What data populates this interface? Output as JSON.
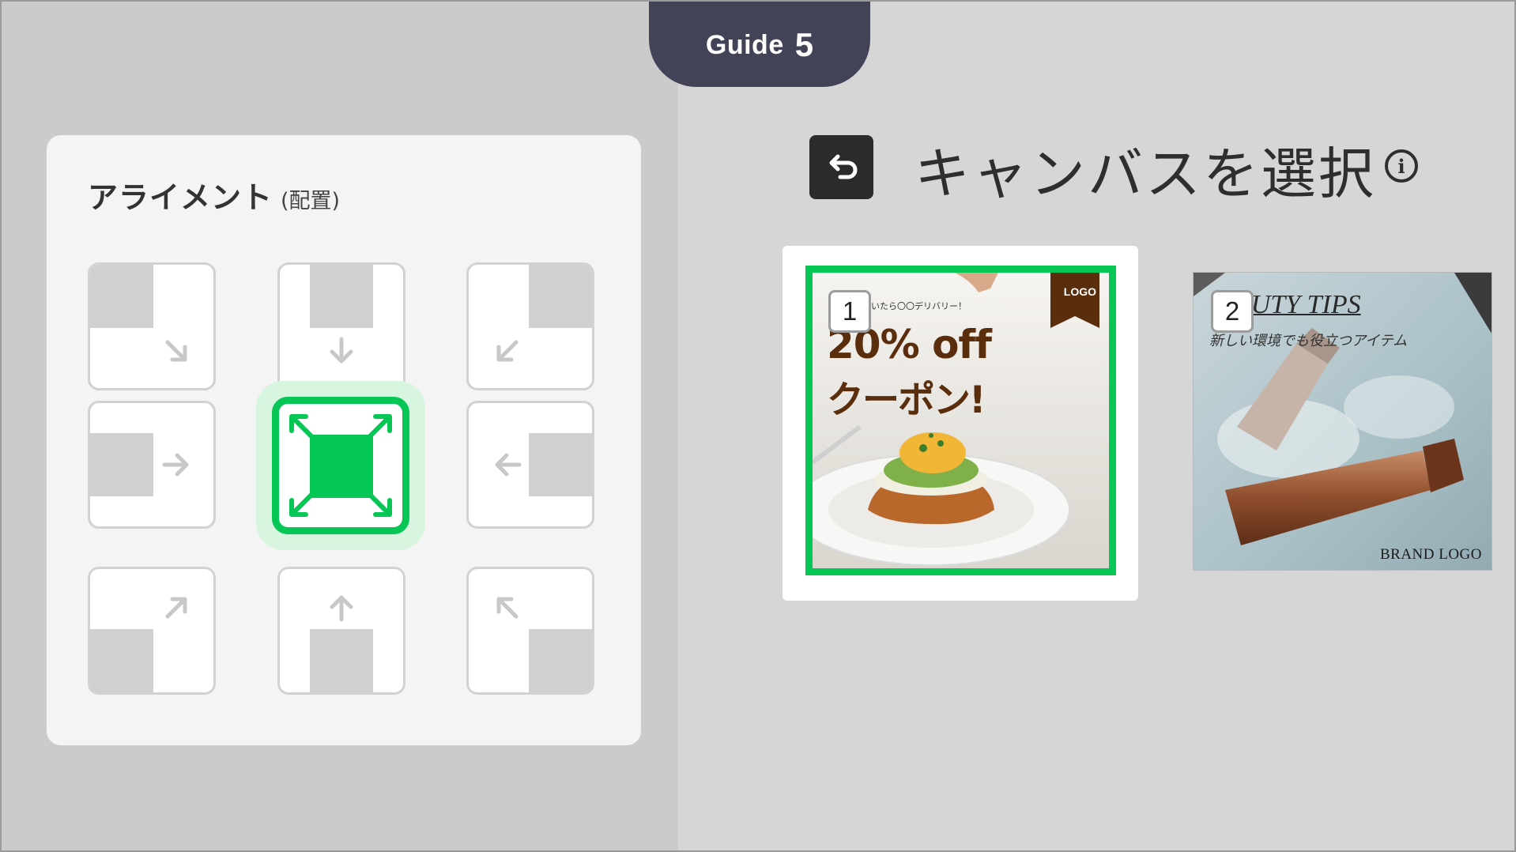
{
  "guide": {
    "label": "Guide",
    "number": "5"
  },
  "alignment_panel": {
    "title": "アライメント",
    "subtitle": "(配置)",
    "options": [
      {
        "position": "top-left",
        "arrow": "arrow-down-right-icon"
      },
      {
        "position": "top-center",
        "arrow": "arrow-down-icon"
      },
      {
        "position": "top-right",
        "arrow": "arrow-down-left-icon"
      },
      {
        "position": "middle-left",
        "arrow": "arrow-right-icon"
      },
      {
        "position": "fill",
        "arrow": "expand-icon",
        "selected": true
      },
      {
        "position": "middle-right",
        "arrow": "arrow-left-icon"
      },
      {
        "position": "bottom-left",
        "arrow": "arrow-up-right-icon"
      },
      {
        "position": "bottom-center",
        "arrow": "arrow-up-icon"
      },
      {
        "position": "bottom-right",
        "arrow": "arrow-up-left-icon"
      }
    ],
    "accent_color": "#06c755"
  },
  "header": {
    "back_icon": "undo-icon",
    "title": "キャンバスを選択",
    "info_icon": "i"
  },
  "canvases": [
    {
      "number": "1",
      "selected": true,
      "small_text": "いたら〇〇デリバリー！",
      "headline_1": "20% off",
      "headline_2": "クーポン!",
      "logo": "LOGO"
    },
    {
      "number": "2",
      "selected": false,
      "title": "AUTY TIPS",
      "subtitle": "新しい環境でも役立つアイテム",
      "brand": "BRAND LOGO"
    }
  ]
}
